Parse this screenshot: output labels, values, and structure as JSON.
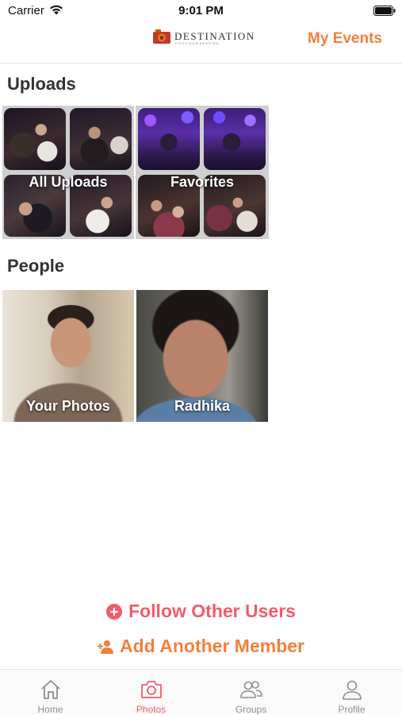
{
  "status_bar": {
    "carrier": "Carrier",
    "time": "9:01 PM"
  },
  "header": {
    "logo_text": "DESTINATION",
    "logo_subtext": "PHOTOGRAPHERS",
    "my_events_label": "My Events"
  },
  "uploads": {
    "title": "Uploads",
    "tiles": [
      {
        "label": "All Uploads"
      },
      {
        "label": "Favorites"
      }
    ]
  },
  "people": {
    "title": "People",
    "tiles": [
      {
        "label": "Your Photos"
      },
      {
        "label": "Radhika"
      }
    ]
  },
  "actions": {
    "follow_label": "Follow Other Users",
    "add_member_label": "Add Another Member"
  },
  "tab_bar": {
    "items": [
      {
        "label": "Home",
        "icon": "home-icon",
        "active": false
      },
      {
        "label": "Photos",
        "icon": "camera-icon",
        "active": true
      },
      {
        "label": "Groups",
        "icon": "groups-icon",
        "active": false
      },
      {
        "label": "Profile",
        "icon": "profile-icon",
        "active": false
      }
    ]
  },
  "colors": {
    "accent_orange": "#f2803d",
    "accent_red": "#f25c6a",
    "tab_inactive": "#8e8e93"
  }
}
